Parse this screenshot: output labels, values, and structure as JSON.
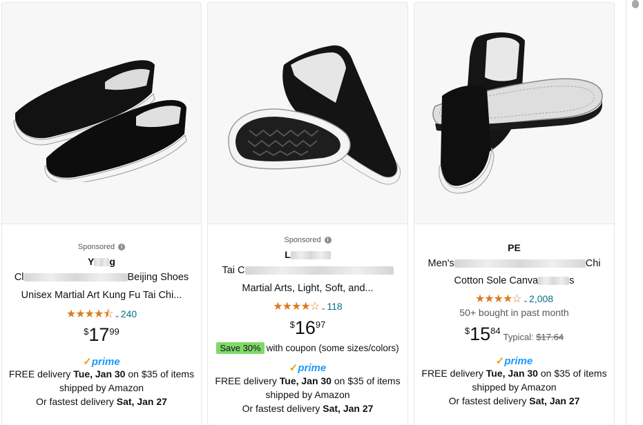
{
  "products": [
    {
      "sponsored": "Sponsored",
      "brand": "Y",
      "brand_tail": "g",
      "title_line1_start": "Cl",
      "title_line1_end": "Beijing Shoes",
      "title_line2": "Unisex Martial Art Kung Fu Tai Chi...",
      "stars": "★★★★⯪",
      "rating_count": "240",
      "price_symbol": "$",
      "price_whole": "17",
      "price_fraction": "99",
      "prime": "prime",
      "delivery_prefix": "FREE delivery ",
      "delivery_date": "Tue, Jan 30",
      "delivery_suffix": " on $35 of items",
      "shipped_by": "shipped by Amazon",
      "fastest_prefix": "Or fastest delivery ",
      "fastest_date": "Sat, Jan 27"
    },
    {
      "sponsored": "Sponsored",
      "brand": "L",
      "title_line1_start": "Tai C",
      "title_line2": "Martial Arts, Light, Soft, and...",
      "stars": "★★★★☆",
      "rating_count": "118",
      "price_symbol": "$",
      "price_whole": "16",
      "price_fraction": "97",
      "coupon_badge": "Save 30%",
      "coupon_text": "with coupon (some sizes/colors)",
      "prime": "prime",
      "delivery_prefix": "FREE delivery ",
      "delivery_date": "Tue, Jan 30",
      "delivery_suffix": " on $35 of items",
      "shipped_by": "shipped by Amazon",
      "fastest_prefix": "Or fastest delivery ",
      "fastest_date": "Sat, Jan 27"
    },
    {
      "brand": "PE",
      "title_line1_start": "Men's",
      "title_line1_end": "Chi",
      "title_line2_start": "Cotton Sole Canva",
      "title_line2_end": "s",
      "stars": "★★★★☆",
      "rating_count": "2,008",
      "bought": "50+ bought in past month",
      "price_symbol": "$",
      "price_whole": "15",
      "price_fraction": "84",
      "typical_label": "Typical: ",
      "typical_price": "$17.64",
      "prime": "prime",
      "delivery_prefix": "FREE delivery ",
      "delivery_date": "Tue, Jan 30",
      "delivery_suffix": " on $35 of items",
      "shipped_by": "shipped by Amazon",
      "fastest_prefix": "Or fastest delivery ",
      "fastest_date": "Sat, Jan 27"
    }
  ],
  "icons": {
    "info": "i",
    "chevron": "⌄",
    "prime_check": "✓"
  },
  "colors": {
    "star": "#de7921",
    "link": "#007185",
    "prime": "#1a98ff",
    "coupon_badge": "#7fda69"
  }
}
